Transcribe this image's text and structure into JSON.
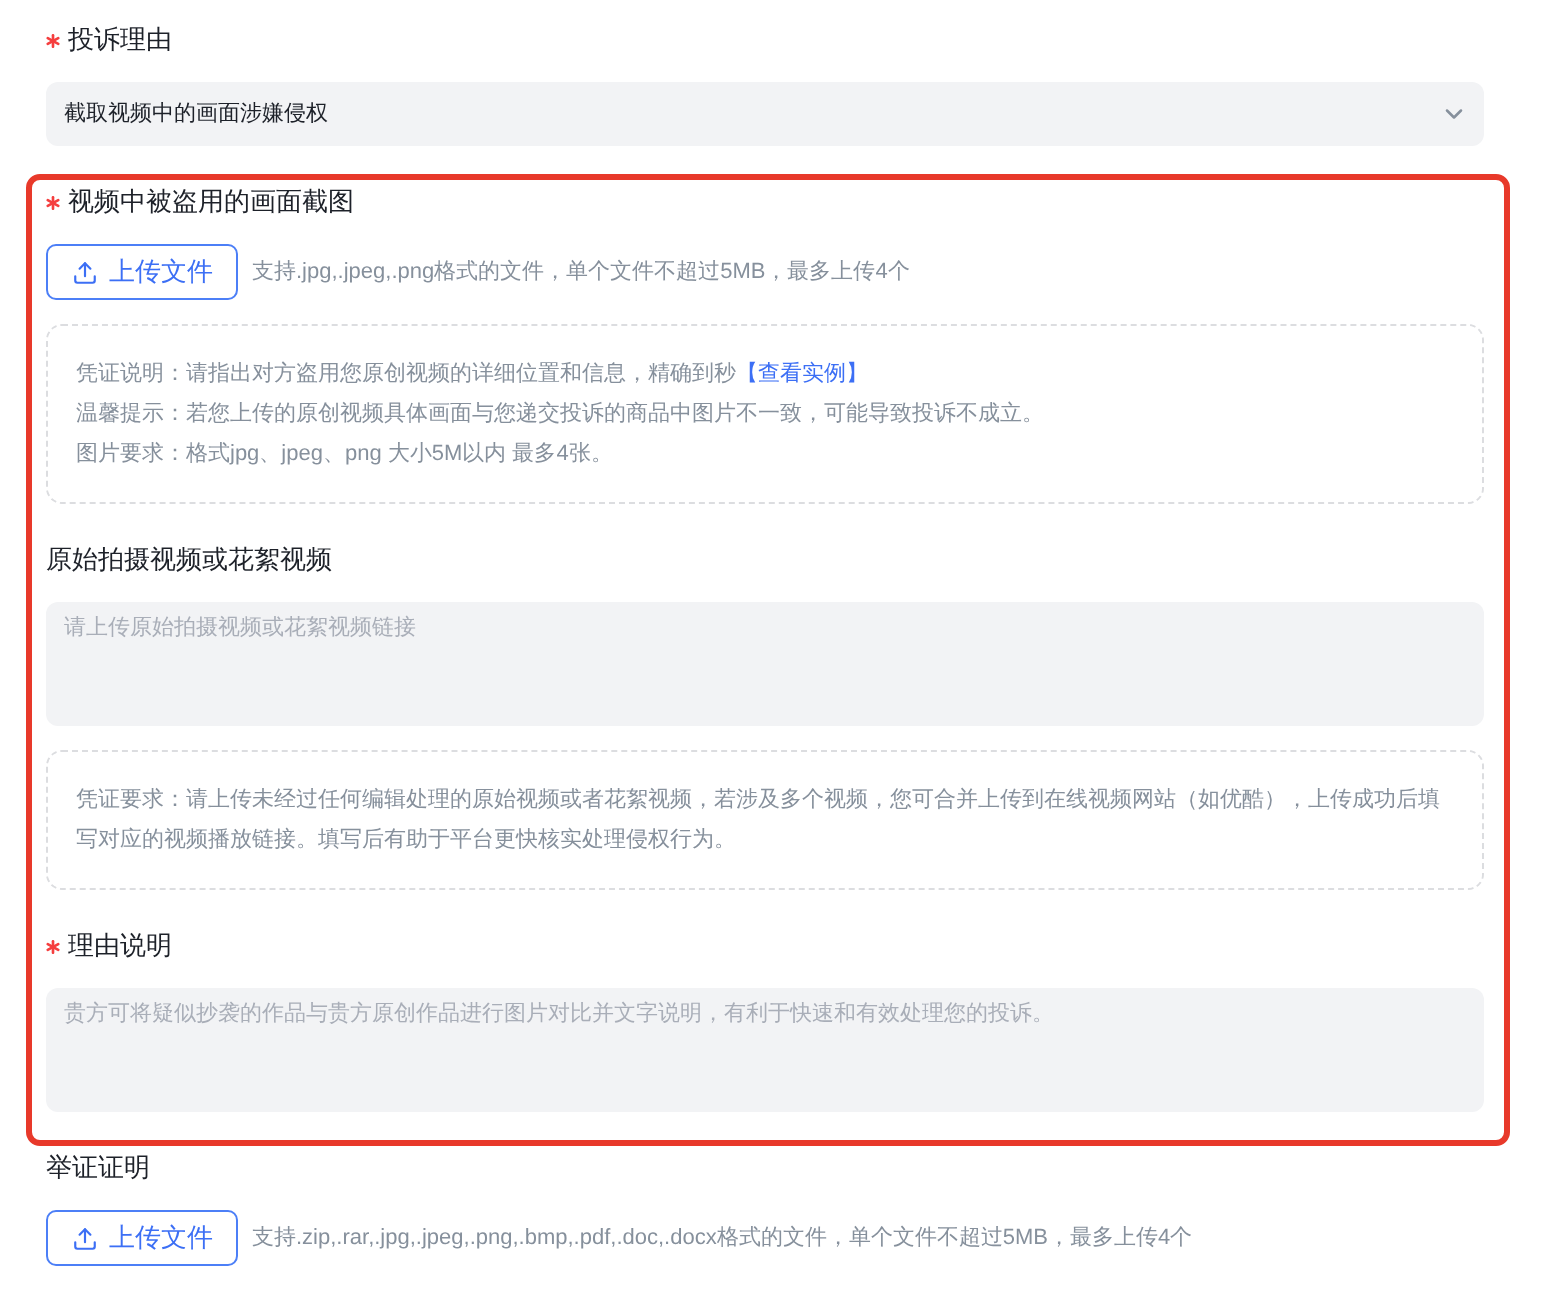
{
  "sections": [
    {
      "highlighted": false,
      "fields": [
        {
          "kind": "select",
          "label": "投诉理由",
          "required": true,
          "value": "截取视频中的画面涉嫌侵权"
        }
      ]
    },
    {
      "highlighted": true,
      "fields": [
        {
          "kind": "upload",
          "label": "视频中被盗用的画面截图",
          "required": true,
          "button": "上传文件",
          "hint": "支持.jpg,.jpeg,.png格式的文件，单个文件不超过5MB，最多上传4个",
          "notes": [
            {
              "text": "凭证说明：请指出对方盗用您原创视频的详细位置和信息，精确到秒",
              "link": "【查看实例】"
            },
            {
              "text": "温馨提示：若您上传的原创视频具体画面与您递交投诉的商品中图片不一致，可能导致投诉不成立。"
            },
            {
              "text": "图片要求：格式jpg、jpeg、png 大小5M以内 最多4张。"
            }
          ]
        },
        {
          "kind": "textarea",
          "label": "原始拍摄视频或花絮视频",
          "required": false,
          "placeholder": "请上传原始拍摄视频或花絮视频链接",
          "notes": [
            {
              "text": "凭证要求：请上传未经过任何编辑处理的原始视频或者花絮视频，若涉及多个视频，您可合并上传到在线视频网站（如优酷），上传成功后填写对应的视频播放链接。填写后有助于平台更快核实处理侵权行为。"
            }
          ]
        },
        {
          "kind": "textarea",
          "label": "理由说明",
          "required": true,
          "placeholder": "贵方可将疑似抄袭的作品与贵方原创作品进行图片对比并文字说明，有利于快速和有效处理您的投诉。"
        }
      ]
    },
    {
      "highlighted": false,
      "fields": [
        {
          "kind": "upload",
          "label": "举证证明",
          "required": false,
          "button": "上传文件",
          "hint": "支持.zip,.rar,.jpg,.jpeg,.png,.bmp,.pdf,.doc,.docx格式的文件，单个文件不超过5MB，最多上传4个"
        }
      ]
    }
  ]
}
